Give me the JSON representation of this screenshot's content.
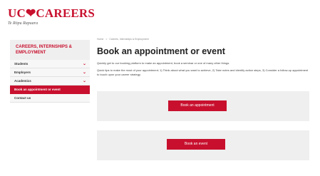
{
  "logo": {
    "title": "UC❤CAREERS",
    "subtitle": "Te Rōpu Rapuara"
  },
  "sidebar": {
    "heading": "CAREERS, INTERNSHIPS & EMPLOYMENT",
    "items": [
      {
        "label": "Students",
        "has_chevron": true
      },
      {
        "label": "Employers",
        "has_chevron": true
      },
      {
        "label": "Academics",
        "has_chevron": true
      },
      {
        "label": "Book an appointment or event",
        "active": true
      },
      {
        "label": "Contact us"
      }
    ],
    "chevron": "⌄"
  },
  "breadcrumb": {
    "items": [
      "Home",
      "Careers, Internships & Employment"
    ],
    "separator": ">"
  },
  "main": {
    "title": "Book an appointment or event",
    "intro": "Quickly get to our booking platform to make an appointment, book a seminar or one of many other things.",
    "tips": "Quick tips to make the most of your appointment; 1) Think about what you want to achieve, 2) Take notes and identify action steps, 3) Consider a follow-up appointment to touch upon your career strategy."
  },
  "cards": {
    "appointment_button": "Book an appointment",
    "event_button": "Book an event"
  },
  "colors": {
    "accent": "#c8102e",
    "panel": "#efefef"
  }
}
